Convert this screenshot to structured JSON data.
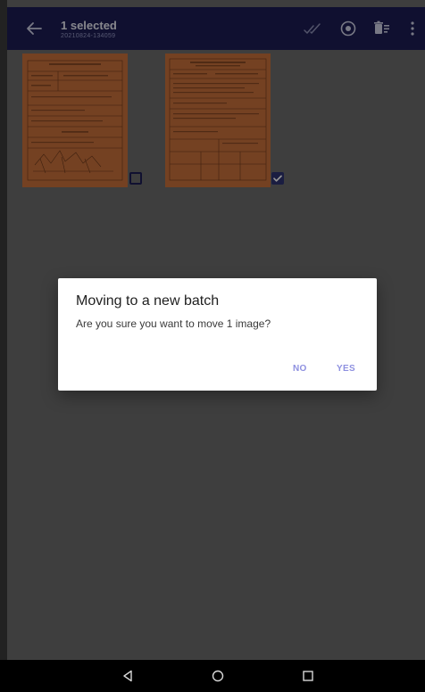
{
  "appbar": {
    "title": "1 selected",
    "subtitle": "20210824-134059",
    "icons": [
      "arrow-back-icon",
      "double-check-icon",
      "radio-target-icon",
      "delete-list-icon",
      "more-vert-icon"
    ]
  },
  "gallery": {
    "items": [
      {
        "thumbnail": "scanned-form-document",
        "selected": false
      },
      {
        "thumbnail": "scanned-form-document",
        "selected": true
      }
    ]
  },
  "dialog": {
    "title": "Moving to a new batch",
    "message": "Are you sure you want to move 1 image?",
    "no_label": "NO",
    "yes_label": "YES"
  },
  "navbar": {
    "icons": [
      "back-triangle-icon",
      "home-circle-icon",
      "recents-square-icon"
    ]
  },
  "colors": {
    "appbar": "#1c1d54",
    "accent": "#8e90e0",
    "scrim": "#6b6b6b",
    "thumbnail": "#c9703b"
  }
}
